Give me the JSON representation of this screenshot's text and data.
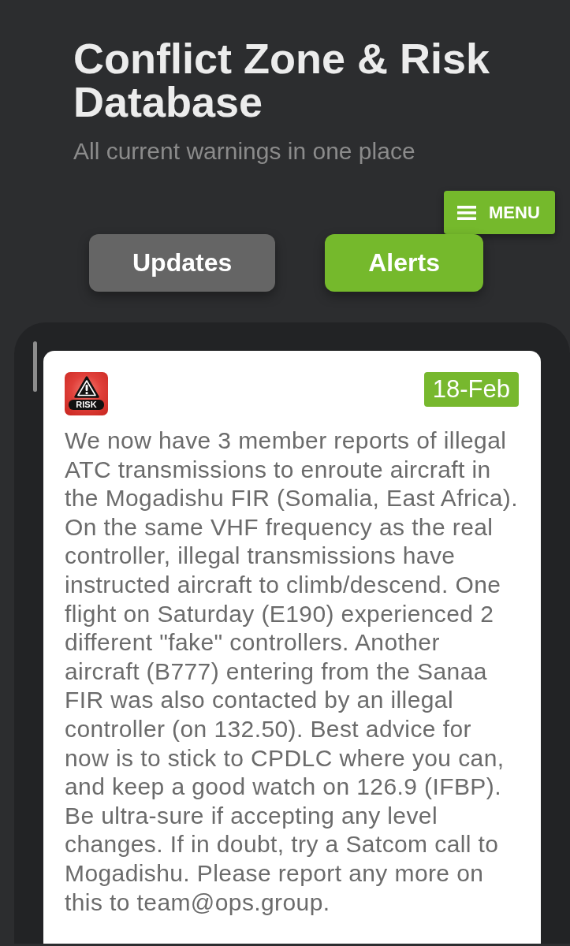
{
  "header": {
    "title": "Conflict Zone & Risk Database",
    "subtitle": "All current warnings in one place"
  },
  "menu_button": {
    "label": "MENU"
  },
  "tabs": [
    {
      "label": "Updates",
      "selected": false
    },
    {
      "label": "Alerts",
      "selected": true
    }
  ],
  "alerts": [
    {
      "badge": "RISK",
      "date": "18-Feb",
      "text": "We now have 3 member reports of illegal ATC transmissions to enroute aircraft in the Mogadishu FIR (Somalia, East Africa). On the same VHF frequency as the real controller, illegal transmissions have instructed aircraft to climb/descend. One flight on Saturday (E190) experienced 2 different \"fake\" controllers. Another aircraft (B777) entering from the Sanaa FIR was also contacted by an illegal controller (on 132.50). Best advice for now is to stick to CPDLC where you can, and keep a good watch on 126.9 (IFBP). Be ultra-sure if accepting any level changes. If in doubt, try a Satcom call to Mogadishu. Please report any more on this to team@ops.group."
    }
  ]
}
